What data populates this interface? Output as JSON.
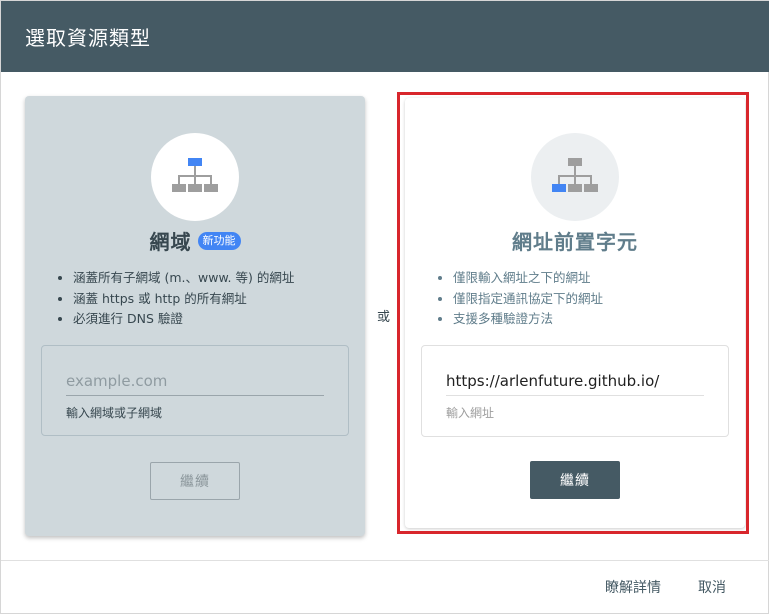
{
  "dialog": {
    "title": "選取資源類型",
    "or_label": "或"
  },
  "domain_card": {
    "icon": "sitemap-icon",
    "title": "網域",
    "badge": "新功能",
    "bullets": [
      "涵蓋所有子網域 (m.、www. 等) 的網址",
      "涵蓋 https 或 http 的所有網址",
      "必須進行 DNS 驗證"
    ],
    "input_value": "",
    "input_placeholder": "example.com",
    "input_helper": "輸入網域或子網域",
    "continue_label": "繼續"
  },
  "prefix_card": {
    "icon": "sitemap-icon",
    "title": "網址前置字元",
    "bullets": [
      "僅限輸入網址之下的網址",
      "僅限指定通訊協定下的網址",
      "支援多種驗證方法"
    ],
    "input_value": "https://arlenfuture.github.io/",
    "input_placeholder": "",
    "input_helper": "輸入網址",
    "continue_label": "繼續"
  },
  "footer": {
    "learn_more_label": "瞭解詳情",
    "cancel_label": "取消"
  },
  "colors": {
    "header": "#455a64",
    "domain_card_bg": "#cfd8dc",
    "highlight_border": "#d8262c",
    "badge": "#4285f4",
    "active_node": "#4285f4",
    "inactive_node": "#9e9e9e"
  }
}
